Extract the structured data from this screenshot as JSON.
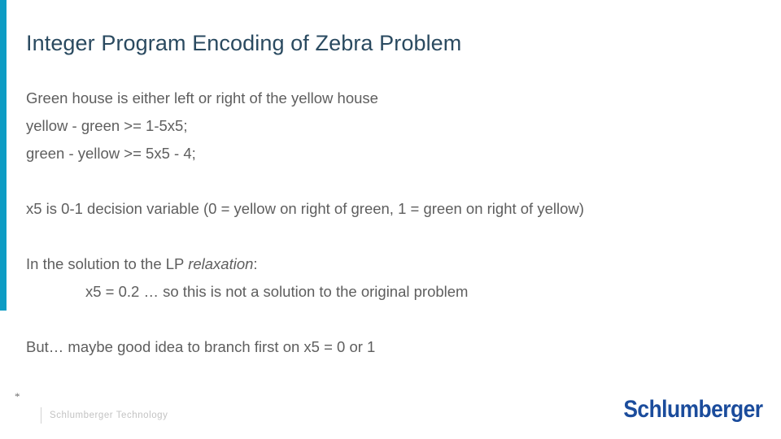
{
  "slide": {
    "title": "Integer Program Encoding of Zebra Problem",
    "accent_color": "#0d9cc4",
    "title_color": "#2a4a60",
    "body_color": "#5e5e5e",
    "background_color": "#ffffff"
  },
  "body": {
    "block1": {
      "line1": "Green house is either left or right of the yellow house",
      "line2": "yellow - green >= 1-5x5;",
      "line3": "green - yellow >= 5x5 - 4;"
    },
    "block2": {
      "line1": "x5 is 0-1 decision variable (0 = yellow on right of green, 1 = green on right of yellow)"
    },
    "block3": {
      "line1_prefix": "In the solution to the LP ",
      "line1_italic": "relaxation",
      "line1_suffix": ":",
      "line2": "x5 = 0.2 … so this is not a solution to the original problem"
    },
    "block4": {
      "line1": "But… maybe good idea to branch first on x5 = 0 or 1"
    }
  },
  "footer": {
    "star_marker": "*",
    "label": "Schlumberger Technology",
    "brand": "Schlumberger",
    "brand_color": "#1b4c9c",
    "label_color": "#c3c3c3"
  }
}
